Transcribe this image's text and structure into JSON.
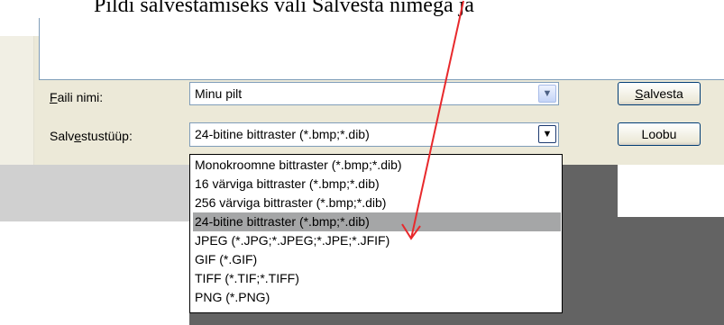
{
  "caption": "Pildi salvestamiseks vali Salvesta nimega ja",
  "dialog": {
    "file_name_label": "Faili nimi:",
    "file_name_value": "Minu pilt",
    "save_type_label_prefix": "Salv",
    "save_type_label_underlined": "e",
    "save_type_label_suffix": "stustüüp:",
    "save_type_value": "24-bitine bittraster (*.bmp;*.dib)",
    "save_button_underlined": "S",
    "save_button_rest": "alvesta",
    "cancel_button": "Loobu"
  },
  "dropdown": {
    "options": [
      "Monokroomne bittraster (*.bmp;*.dib)",
      "16 värviga bittraster (*.bmp;*.dib)",
      "256 värviga bittraster (*.bmp;*.dib)",
      "24-bitine bittraster (*.bmp;*.dib)",
      "JPEG (*.JPG;*.JPEG;*.JPE;*.JFIF)",
      "GIF (*.GIF)",
      "TIFF (*.TIF;*.TIFF)",
      "PNG (*.PNG)"
    ],
    "selected_index": 3
  },
  "icons": {
    "dropdown_arrow": "chevron-down-icon",
    "annotation_arrow": "red-arrow-icon"
  },
  "colors": {
    "dialog_bg": "#ece9d8",
    "selection": "#a5a6a7",
    "annotation_arrow": "#e8292c",
    "background_dark": "#636363"
  }
}
